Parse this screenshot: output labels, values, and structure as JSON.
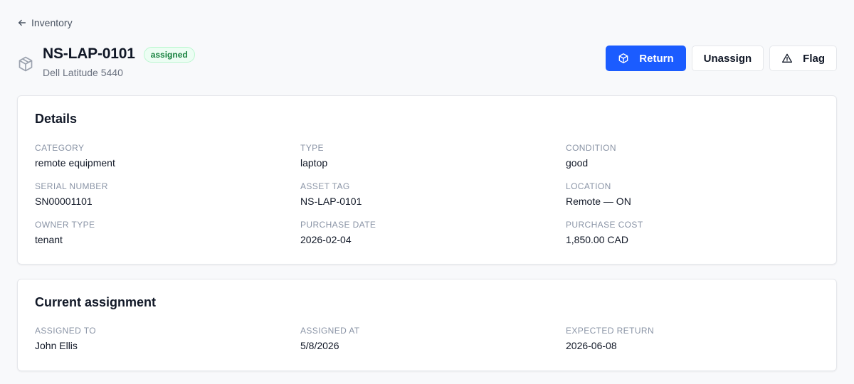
{
  "breadcrumb": {
    "back_label": "Inventory"
  },
  "asset": {
    "id": "NS-LAP-0101",
    "model": "Dell Latitude 5440",
    "status": "assigned",
    "status_color": "#15803d"
  },
  "actions": {
    "return_label": "Return",
    "unassign_label": "Unassign",
    "flag_label": "Flag",
    "primary_color": "#1b5cff"
  },
  "details": {
    "title": "Details",
    "fields": [
      {
        "label": "CATEGORY",
        "value": "remote equipment"
      },
      {
        "label": "TYPE",
        "value": "laptop"
      },
      {
        "label": "CONDITION",
        "value": "good"
      },
      {
        "label": "SERIAL NUMBER",
        "value": "SN00001101"
      },
      {
        "label": "ASSET TAG",
        "value": "NS-LAP-0101"
      },
      {
        "label": "LOCATION",
        "value": "Remote — ON"
      },
      {
        "label": "OWNER TYPE",
        "value": "tenant"
      },
      {
        "label": "PURCHASE DATE",
        "value": "2026-02-04"
      },
      {
        "label": "PURCHASE COST",
        "value": "1,850.00 CAD"
      }
    ]
  },
  "assignment": {
    "title": "Current assignment",
    "fields": [
      {
        "label": "ASSIGNED TO",
        "value": "John Ellis"
      },
      {
        "label": "ASSIGNED AT",
        "value": "5/8/2026"
      },
      {
        "label": "EXPECTED RETURN",
        "value": "2026-06-08"
      }
    ]
  },
  "icons": {
    "back": "arrow-left-icon",
    "asset": "package-icon",
    "return": "package-icon",
    "flag": "alert-triangle-icon"
  }
}
